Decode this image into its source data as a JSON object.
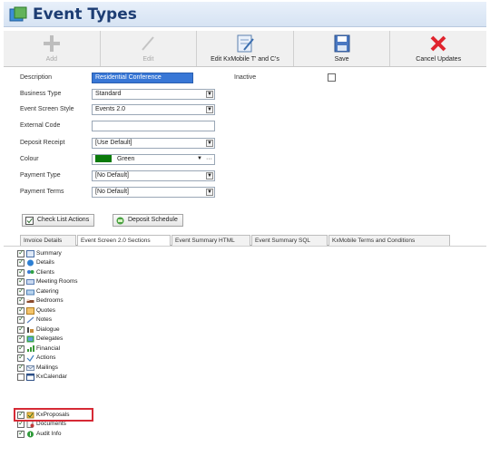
{
  "window": {
    "title": "Event Types"
  },
  "toolbar": {
    "add": "Add",
    "edit": "Edit",
    "edit_kx": "Edit KxMobile T' and C's",
    "save": "Save",
    "cancel": "Cancel Updates"
  },
  "form": {
    "description": {
      "label": "Description",
      "value": "Residential Conference"
    },
    "inactive": {
      "label": "Inactive",
      "checked": false
    },
    "business_type": {
      "label": "Business Type",
      "value": "Standard"
    },
    "event_screen_style": {
      "label": "Event Screen Style",
      "value": "Events 2.0"
    },
    "external_code": {
      "label": "External Code",
      "value": ""
    },
    "deposit_receipt": {
      "label": "Deposit Receipt",
      "value": "[Use Default]"
    },
    "colour": {
      "label": "Colour",
      "value": "Green",
      "swatch": "#0a7a0a"
    },
    "payment_type": {
      "label": "Payment Type",
      "value": "[No Default]"
    },
    "payment_terms": {
      "label": "Payment Terms",
      "value": "[No Default]"
    }
  },
  "actions": {
    "check_list": "Check List Actions",
    "deposit_schedule": "Deposit Schedule"
  },
  "tabs": [
    {
      "label": "Invoice Details"
    },
    {
      "label": "Event Screen 2.0 Sections"
    },
    {
      "label": "Event Summary HTML"
    },
    {
      "label": "Event Summary SQL"
    },
    {
      "label": "KxMobile Terms and Conditions"
    }
  ],
  "active_tab": "Event Screen 2.0 Sections",
  "sections": [
    {
      "label": "Summary",
      "checked": true,
      "icon": "summary-icon"
    },
    {
      "label": "Details",
      "checked": true,
      "icon": "details-icon"
    },
    {
      "label": "Clients",
      "checked": true,
      "icon": "clients-icon"
    },
    {
      "label": "Meeting Rooms",
      "checked": true,
      "icon": "meeting-rooms-icon"
    },
    {
      "label": "Catering",
      "checked": true,
      "icon": "catering-icon"
    },
    {
      "label": "Bedrooms",
      "checked": true,
      "icon": "bedrooms-icon"
    },
    {
      "label": "Quotes",
      "checked": true,
      "icon": "quotes-icon"
    },
    {
      "label": "Notes",
      "checked": true,
      "icon": "notes-icon"
    },
    {
      "label": "Dialogue",
      "checked": true,
      "icon": "dialogue-icon"
    },
    {
      "label": "Delegates",
      "checked": true,
      "icon": "delegates-icon"
    },
    {
      "label": "Financial",
      "checked": true,
      "icon": "financial-icon"
    },
    {
      "label": "Actions",
      "checked": true,
      "icon": "actions-icon"
    },
    {
      "label": "Mailings",
      "checked": true,
      "icon": "mailings-icon"
    },
    {
      "label": "KxCalendar",
      "checked": false,
      "icon": "calendar-icon"
    },
    {
      "label": "KxProposals",
      "checked": true,
      "icon": "proposals-icon"
    },
    {
      "label": "Documents",
      "checked": true,
      "icon": "documents-icon"
    },
    {
      "label": "Audit Info",
      "checked": true,
      "icon": "audit-info-icon"
    }
  ],
  "colors": {
    "accent": "#1d3d73",
    "highlight": "#d62a35",
    "selection": "#3877d6"
  }
}
